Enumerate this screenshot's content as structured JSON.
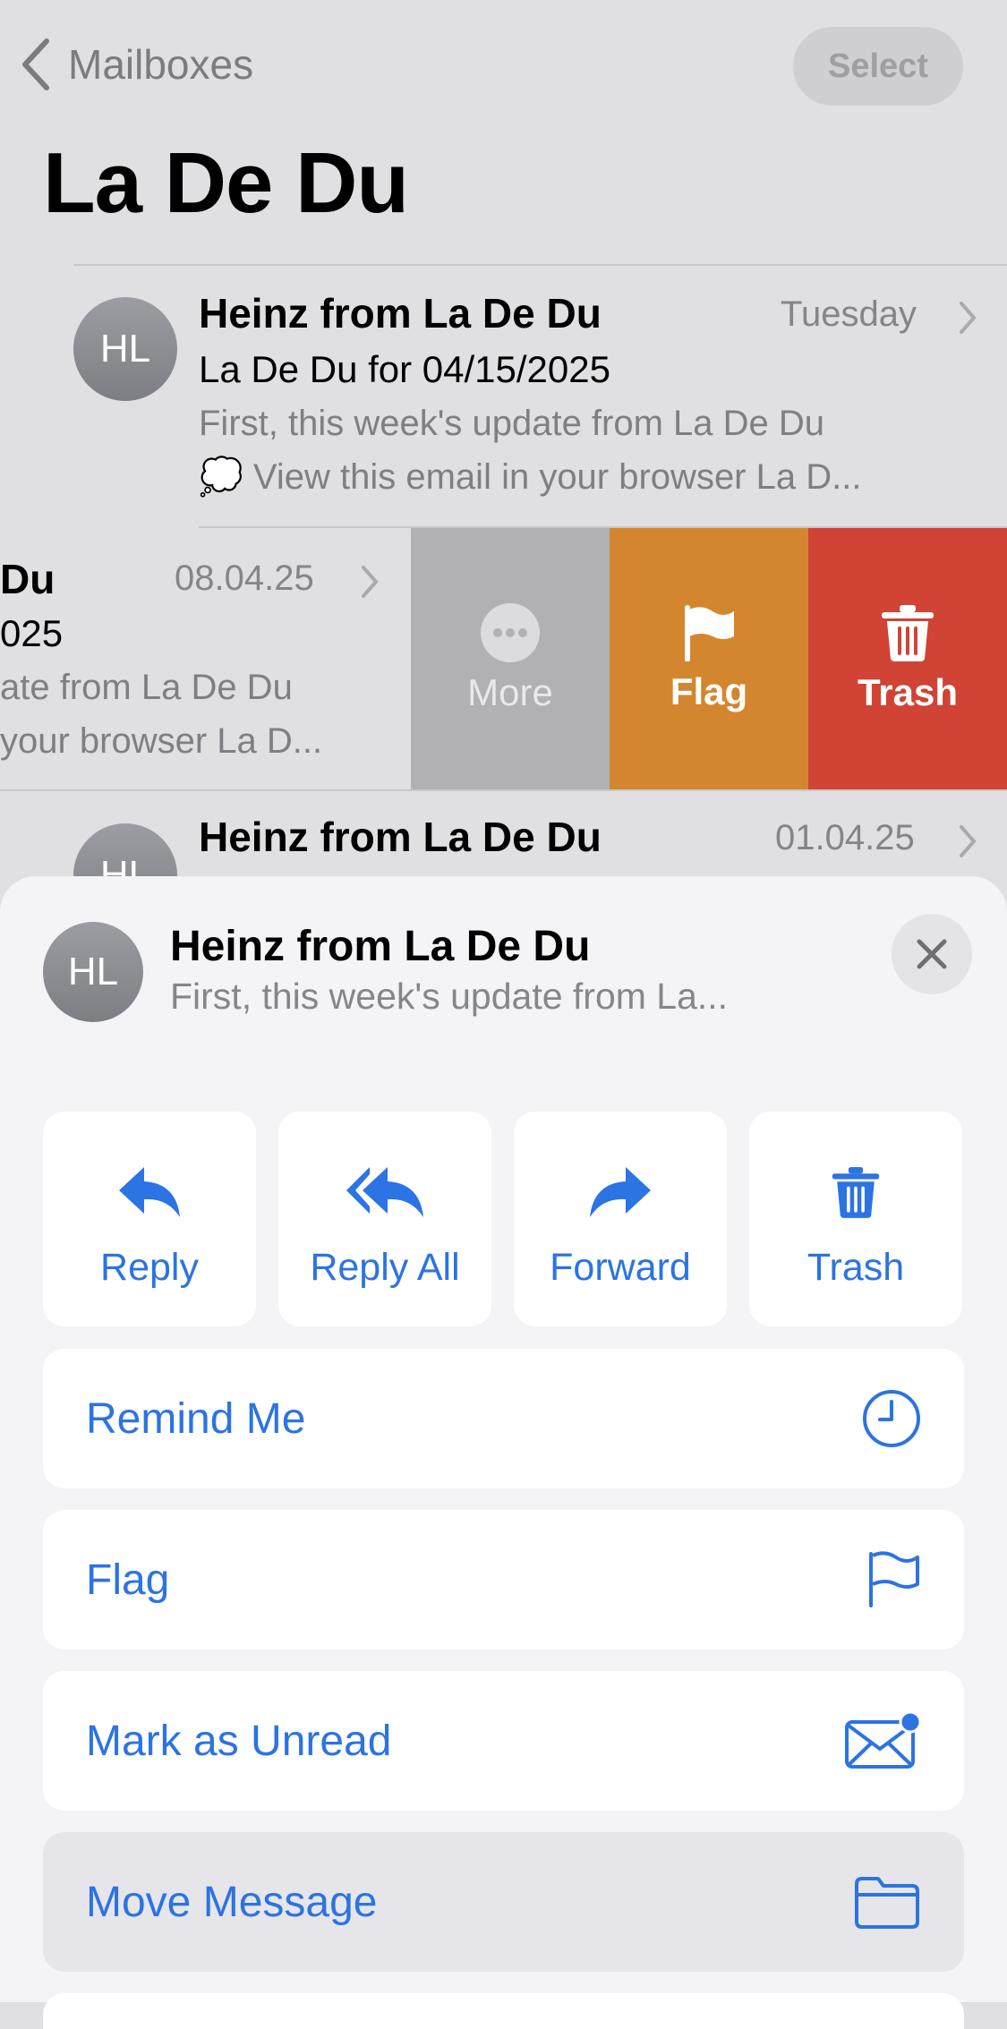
{
  "nav": {
    "back_label": "Mailboxes",
    "select_label": "Select"
  },
  "mailbox": {
    "title": "La De Du"
  },
  "messages": [
    {
      "avatar": "HL",
      "sender": "Heinz from La De Du",
      "date": "Tuesday",
      "subject": "La De Du for 04/15/2025",
      "preview_line1": "First, this week's update from La De Du",
      "preview_line2": "💭 View this email in your browser La D..."
    },
    {
      "sender_partial": "Du",
      "date": "08.04.25",
      "subject_partial": "025",
      "preview_line1": "ate from La De Du",
      "preview_line2": "your browser La D..."
    },
    {
      "avatar": "HL",
      "sender": "Heinz from La De Du",
      "date": "01.04.25"
    }
  ],
  "swipe_actions": [
    {
      "label": "More",
      "icon": "ellipsis-circle-icon",
      "color": "#b0b0b5"
    },
    {
      "label": "Flag",
      "icon": "flag-icon",
      "color": "#d4862f"
    },
    {
      "label": "Trash",
      "icon": "trash-icon",
      "color": "#d04335"
    }
  ],
  "sheet": {
    "avatar": "HL",
    "sender": "Heinz from La De Du",
    "preview": "First, this week's update from La...",
    "quick_actions": [
      {
        "label": "Reply",
        "icon": "reply-icon"
      },
      {
        "label": "Reply All",
        "icon": "reply-all-icon"
      },
      {
        "label": "Forward",
        "icon": "forward-icon"
      },
      {
        "label": "Trash",
        "icon": "trash-icon"
      }
    ],
    "menu": [
      {
        "label": "Remind Me",
        "icon": "clock-icon"
      },
      {
        "label": "Flag",
        "icon": "flag-outline-icon"
      },
      {
        "label": "Mark as Unread",
        "icon": "envelope-unread-icon"
      },
      {
        "label": "Move Message",
        "icon": "folder-icon"
      }
    ]
  },
  "colors": {
    "accent": "#2c73e3",
    "background": "#e0e0e2",
    "sheet": "#f4f4f6"
  }
}
